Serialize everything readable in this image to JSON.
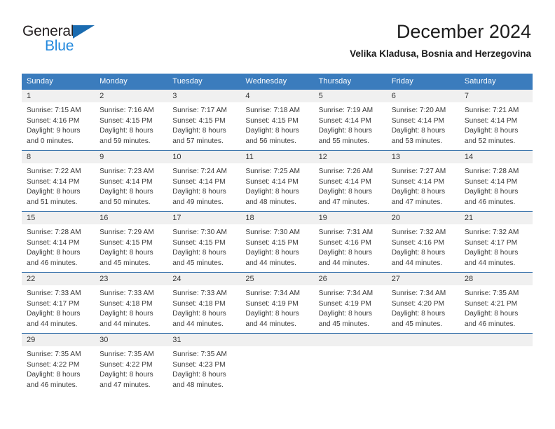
{
  "brand": {
    "name_top": "General",
    "name_bottom": "Blue",
    "triangle_icon": "triangle-logo-icon",
    "color_top": "#231f20",
    "color_bottom": "#2288dd",
    "triangle_color": "#1a6bb0"
  },
  "header": {
    "title": "December 2024",
    "subtitle": "Velika Kladusa, Bosnia and Herzegovina"
  },
  "theme": {
    "header_bg": "#3b7cbd",
    "row_divider": "#2f6ca8",
    "daynum_band_bg": "#f0f0f0",
    "text": "#3a3a3a"
  },
  "weekday_headers": [
    "Sunday",
    "Monday",
    "Tuesday",
    "Wednesday",
    "Thursday",
    "Friday",
    "Saturday"
  ],
  "weeks": [
    [
      {
        "day": "1",
        "sunrise": "Sunrise: 7:15 AM",
        "sunset": "Sunset: 4:16 PM",
        "daylight1": "Daylight: 9 hours",
        "daylight2": "and 0 minutes."
      },
      {
        "day": "2",
        "sunrise": "Sunrise: 7:16 AM",
        "sunset": "Sunset: 4:15 PM",
        "daylight1": "Daylight: 8 hours",
        "daylight2": "and 59 minutes."
      },
      {
        "day": "3",
        "sunrise": "Sunrise: 7:17 AM",
        "sunset": "Sunset: 4:15 PM",
        "daylight1": "Daylight: 8 hours",
        "daylight2": "and 57 minutes."
      },
      {
        "day": "4",
        "sunrise": "Sunrise: 7:18 AM",
        "sunset": "Sunset: 4:15 PM",
        "daylight1": "Daylight: 8 hours",
        "daylight2": "and 56 minutes."
      },
      {
        "day": "5",
        "sunrise": "Sunrise: 7:19 AM",
        "sunset": "Sunset: 4:14 PM",
        "daylight1": "Daylight: 8 hours",
        "daylight2": "and 55 minutes."
      },
      {
        "day": "6",
        "sunrise": "Sunrise: 7:20 AM",
        "sunset": "Sunset: 4:14 PM",
        "daylight1": "Daylight: 8 hours",
        "daylight2": "and 53 minutes."
      },
      {
        "day": "7",
        "sunrise": "Sunrise: 7:21 AM",
        "sunset": "Sunset: 4:14 PM",
        "daylight1": "Daylight: 8 hours",
        "daylight2": "and 52 minutes."
      }
    ],
    [
      {
        "day": "8",
        "sunrise": "Sunrise: 7:22 AM",
        "sunset": "Sunset: 4:14 PM",
        "daylight1": "Daylight: 8 hours",
        "daylight2": "and 51 minutes."
      },
      {
        "day": "9",
        "sunrise": "Sunrise: 7:23 AM",
        "sunset": "Sunset: 4:14 PM",
        "daylight1": "Daylight: 8 hours",
        "daylight2": "and 50 minutes."
      },
      {
        "day": "10",
        "sunrise": "Sunrise: 7:24 AM",
        "sunset": "Sunset: 4:14 PM",
        "daylight1": "Daylight: 8 hours",
        "daylight2": "and 49 minutes."
      },
      {
        "day": "11",
        "sunrise": "Sunrise: 7:25 AM",
        "sunset": "Sunset: 4:14 PM",
        "daylight1": "Daylight: 8 hours",
        "daylight2": "and 48 minutes."
      },
      {
        "day": "12",
        "sunrise": "Sunrise: 7:26 AM",
        "sunset": "Sunset: 4:14 PM",
        "daylight1": "Daylight: 8 hours",
        "daylight2": "and 47 minutes."
      },
      {
        "day": "13",
        "sunrise": "Sunrise: 7:27 AM",
        "sunset": "Sunset: 4:14 PM",
        "daylight1": "Daylight: 8 hours",
        "daylight2": "and 47 minutes."
      },
      {
        "day": "14",
        "sunrise": "Sunrise: 7:28 AM",
        "sunset": "Sunset: 4:14 PM",
        "daylight1": "Daylight: 8 hours",
        "daylight2": "and 46 minutes."
      }
    ],
    [
      {
        "day": "15",
        "sunrise": "Sunrise: 7:28 AM",
        "sunset": "Sunset: 4:14 PM",
        "daylight1": "Daylight: 8 hours",
        "daylight2": "and 46 minutes."
      },
      {
        "day": "16",
        "sunrise": "Sunrise: 7:29 AM",
        "sunset": "Sunset: 4:15 PM",
        "daylight1": "Daylight: 8 hours",
        "daylight2": "and 45 minutes."
      },
      {
        "day": "17",
        "sunrise": "Sunrise: 7:30 AM",
        "sunset": "Sunset: 4:15 PM",
        "daylight1": "Daylight: 8 hours",
        "daylight2": "and 45 minutes."
      },
      {
        "day": "18",
        "sunrise": "Sunrise: 7:30 AM",
        "sunset": "Sunset: 4:15 PM",
        "daylight1": "Daylight: 8 hours",
        "daylight2": "and 44 minutes."
      },
      {
        "day": "19",
        "sunrise": "Sunrise: 7:31 AM",
        "sunset": "Sunset: 4:16 PM",
        "daylight1": "Daylight: 8 hours",
        "daylight2": "and 44 minutes."
      },
      {
        "day": "20",
        "sunrise": "Sunrise: 7:32 AM",
        "sunset": "Sunset: 4:16 PM",
        "daylight1": "Daylight: 8 hours",
        "daylight2": "and 44 minutes."
      },
      {
        "day": "21",
        "sunrise": "Sunrise: 7:32 AM",
        "sunset": "Sunset: 4:17 PM",
        "daylight1": "Daylight: 8 hours",
        "daylight2": "and 44 minutes."
      }
    ],
    [
      {
        "day": "22",
        "sunrise": "Sunrise: 7:33 AM",
        "sunset": "Sunset: 4:17 PM",
        "daylight1": "Daylight: 8 hours",
        "daylight2": "and 44 minutes."
      },
      {
        "day": "23",
        "sunrise": "Sunrise: 7:33 AM",
        "sunset": "Sunset: 4:18 PM",
        "daylight1": "Daylight: 8 hours",
        "daylight2": "and 44 minutes."
      },
      {
        "day": "24",
        "sunrise": "Sunrise: 7:33 AM",
        "sunset": "Sunset: 4:18 PM",
        "daylight1": "Daylight: 8 hours",
        "daylight2": "and 44 minutes."
      },
      {
        "day": "25",
        "sunrise": "Sunrise: 7:34 AM",
        "sunset": "Sunset: 4:19 PM",
        "daylight1": "Daylight: 8 hours",
        "daylight2": "and 44 minutes."
      },
      {
        "day": "26",
        "sunrise": "Sunrise: 7:34 AM",
        "sunset": "Sunset: 4:19 PM",
        "daylight1": "Daylight: 8 hours",
        "daylight2": "and 45 minutes."
      },
      {
        "day": "27",
        "sunrise": "Sunrise: 7:34 AM",
        "sunset": "Sunset: 4:20 PM",
        "daylight1": "Daylight: 8 hours",
        "daylight2": "and 45 minutes."
      },
      {
        "day": "28",
        "sunrise": "Sunrise: 7:35 AM",
        "sunset": "Sunset: 4:21 PM",
        "daylight1": "Daylight: 8 hours",
        "daylight2": "and 46 minutes."
      }
    ],
    [
      {
        "day": "29",
        "sunrise": "Sunrise: 7:35 AM",
        "sunset": "Sunset: 4:22 PM",
        "daylight1": "Daylight: 8 hours",
        "daylight2": "and 46 minutes."
      },
      {
        "day": "30",
        "sunrise": "Sunrise: 7:35 AM",
        "sunset": "Sunset: 4:22 PM",
        "daylight1": "Daylight: 8 hours",
        "daylight2": "and 47 minutes."
      },
      {
        "day": "31",
        "sunrise": "Sunrise: 7:35 AM",
        "sunset": "Sunset: 4:23 PM",
        "daylight1": "Daylight: 8 hours",
        "daylight2": "and 48 minutes."
      },
      {
        "day": "",
        "sunrise": "",
        "sunset": "",
        "daylight1": "",
        "daylight2": ""
      },
      {
        "day": "",
        "sunrise": "",
        "sunset": "",
        "daylight1": "",
        "daylight2": ""
      },
      {
        "day": "",
        "sunrise": "",
        "sunset": "",
        "daylight1": "",
        "daylight2": ""
      },
      {
        "day": "",
        "sunrise": "",
        "sunset": "",
        "daylight1": "",
        "daylight2": ""
      }
    ]
  ]
}
